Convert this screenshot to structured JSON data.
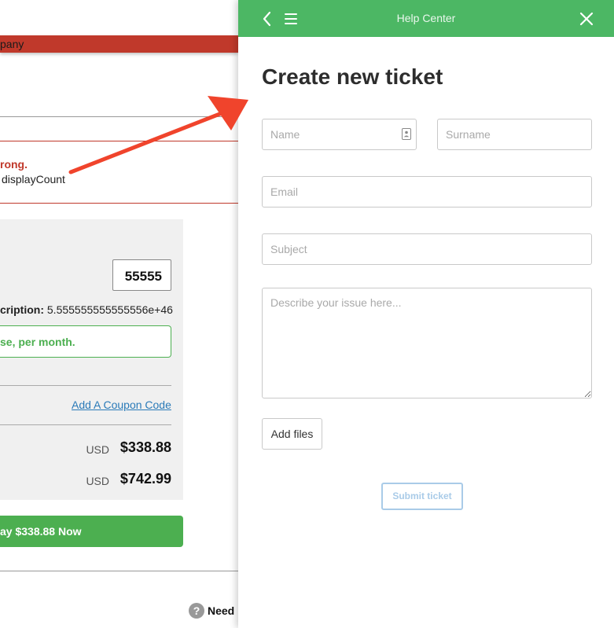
{
  "background_page": {
    "alert_bar_text": "pany",
    "error_title": "rong.",
    "error_message": "displayCount",
    "quantity_value": "55555",
    "subscription_label": "cription:",
    "subscription_value": "5.555555555555556e+46",
    "green_notice": "se, per month.",
    "coupon_link": "Add A Coupon Code",
    "prices": [
      {
        "currency": "USD",
        "amount": "$338.88"
      },
      {
        "currency": "USD",
        "amount": "$742.99"
      }
    ],
    "pay_button": "ay $338.88 Now",
    "help_link": "Need",
    "help_icon_glyph": "?"
  },
  "help_center": {
    "header": {
      "title": "Help Center",
      "icons": [
        "back-chevron-icon",
        "menu-icon",
        "close-icon"
      ],
      "color": "#4cb764"
    },
    "form_title": "Create new ticket",
    "fields": {
      "name_placeholder": "Name",
      "surname_placeholder": "Surname",
      "email_placeholder": "Email",
      "subject_placeholder": "Subject",
      "description_placeholder": "Describe your issue here..."
    },
    "add_files_label": "Add files",
    "submit_label": "Submit ticket"
  },
  "colors": {
    "accent_green": "#4cb764",
    "alert_red": "#c0392b",
    "annotation_arrow": "#f0442c",
    "link_blue": "#2a7ab8"
  }
}
